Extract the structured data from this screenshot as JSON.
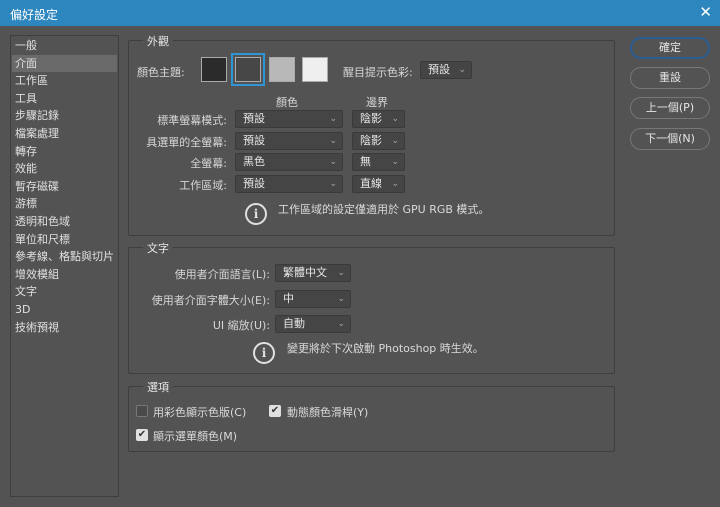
{
  "window": {
    "title": "偏好設定"
  },
  "sidebar": {
    "items": [
      {
        "label": "一般"
      },
      {
        "label": "介面",
        "selected": true
      },
      {
        "label": "工作區"
      },
      {
        "label": "工具"
      },
      {
        "label": "步驟記錄"
      },
      {
        "label": "檔案處理"
      },
      {
        "label": "轉存"
      },
      {
        "label": "效能"
      },
      {
        "label": "暫存磁碟"
      },
      {
        "label": "游標"
      },
      {
        "label": "透明和色域"
      },
      {
        "label": "單位和尺標"
      },
      {
        "label": "參考線、格點與切片"
      },
      {
        "label": "增效模組"
      },
      {
        "label": "文字"
      },
      {
        "label": "3D"
      },
      {
        "label": "技術預視"
      }
    ]
  },
  "appearance": {
    "title": "外觀",
    "color_theme_label": "顏色主題:",
    "themes": [
      {
        "color": "#2b2b2b"
      },
      {
        "color": "#474747",
        "selected": true
      },
      {
        "color": "#b8b8b8"
      },
      {
        "color": "#efefef"
      }
    ],
    "highlight_label": "醒目提示色彩:",
    "highlight_value": "預設",
    "col_color": "顏色",
    "col_border": "邊界",
    "rows": [
      {
        "label": "標準螢幕模式:",
        "color": "預設",
        "border": "陰影"
      },
      {
        "label": "具選單的全螢幕:",
        "color": "預設",
        "border": "陰影"
      },
      {
        "label": "全螢幕:",
        "color": "黑色",
        "border": "無"
      },
      {
        "label": "工作區域:",
        "color": "預設",
        "border": "直線"
      }
    ],
    "note": "工作區域的設定僅適用於 GPU RGB 模式。"
  },
  "text": {
    "title": "文字",
    "language_label": "使用者介面語言(L):",
    "language_value": "繁體中文",
    "fontsize_label": "使用者介面字體大小(E):",
    "fontsize_value": "中",
    "scale_label": "UI 縮放(U):",
    "scale_value": "自動",
    "note": "變更將於下次啟動 Photoshop 時生效。"
  },
  "options": {
    "title": "選項",
    "color_channels": {
      "label": "用彩色顯示色版(C)",
      "checked": false
    },
    "dynamic_sliders": {
      "label": "動態顏色滑桿(Y)",
      "checked": true
    },
    "menu_colors": {
      "label": "顯示選單顏色(M)",
      "checked": true
    }
  },
  "buttons": {
    "ok": "確定",
    "reset": "重設",
    "prev": "上一個(P)",
    "next": "下一個(N)"
  },
  "icons": {
    "close": "✕",
    "chevron": "⌄",
    "info": "i",
    "check": "✔"
  }
}
